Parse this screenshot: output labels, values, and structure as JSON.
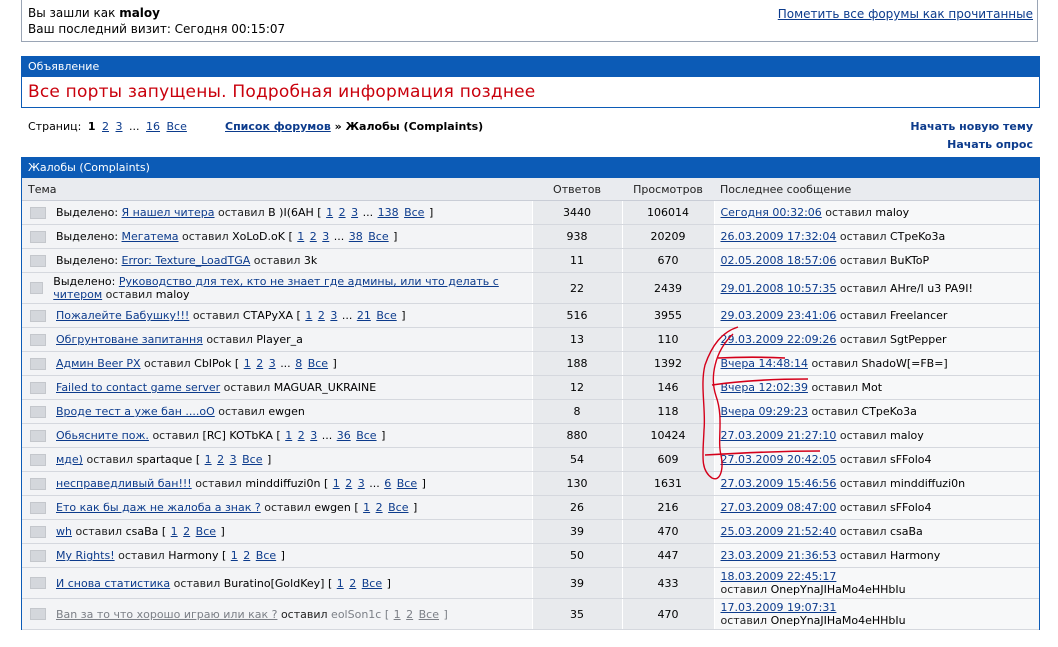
{
  "login": {
    "logged_as_prefix": "Вы зашли как",
    "username": "maloy",
    "last_visit": "Ваш последний визит: Сегодня 00:15:07",
    "mark_read": "Пометить все форумы как прочитанные"
  },
  "announcement": {
    "header": "Объявление",
    "text": "Все порты запущены. Подробная информация позднее"
  },
  "pager": {
    "label": "Страниц:",
    "current": "1",
    "p2": "2",
    "p3": "3",
    "dots": "...",
    "last": "16",
    "all": "Все"
  },
  "breadcrumb": {
    "link": "Список форумов",
    "sep": "»",
    "current": "Жалобы (Complaints)"
  },
  "actions": {
    "new_topic": "Начать новую тему",
    "new_poll": "Начать опрос"
  },
  "forum": {
    "title": "Жалобы (Complaints)",
    "col_topic": "Тема",
    "col_replies": "Ответов",
    "col_views": "Просмотров",
    "col_last": "Последнее сообщение"
  },
  "rows": [
    {
      "prefix": "Выделено:",
      "title": "Я нашел читера",
      "by": "оставил",
      "author": "B )I(6AH",
      "pages": [
        "1",
        "2",
        "3",
        "...",
        "138",
        "Все"
      ],
      "replies": "3440",
      "views": "106014",
      "last_date": "Сегодня 00:32:06",
      "last_by": "оставил",
      "last_author": "maloy"
    },
    {
      "prefix": "Выделено:",
      "title": "Мегатема",
      "by": "оставил",
      "author": "XoLoD.oK",
      "pages": [
        "1",
        "2",
        "3",
        "...",
        "38",
        "Все"
      ],
      "replies": "938",
      "views": "20209",
      "last_date": "26.03.2009 17:32:04",
      "last_by": "оставил",
      "last_author": "CTpeKo3a"
    },
    {
      "prefix": "Выделено:",
      "title": "Error: Texture_LoadTGA",
      "by": "оставил",
      "author": "3k",
      "pages": [],
      "replies": "11",
      "views": "670",
      "last_date": "02.05.2008 18:57:06",
      "last_by": "оставил",
      "last_author": "BuKToP"
    },
    {
      "prefix": "Выделено:",
      "title": "Руководство для тех, кто не знает где админы, или что делать с читером",
      "by": "оставил",
      "author": "maloy",
      "pages": [],
      "replies": "22",
      "views": "2439",
      "last_date": "29.01.2008 10:57:35",
      "last_by": "оставил",
      "last_author": "AHre/I u3 PA9I!"
    },
    {
      "prefix": "",
      "title": "Пожалейте Бабушку!!!",
      "by": "оставил",
      "author": "СТАРуХА",
      "pages": [
        "1",
        "2",
        "3",
        "...",
        "21",
        "Все"
      ],
      "replies": "516",
      "views": "3955",
      "last_date": "29.03.2009 23:41:06",
      "last_by": "оставил",
      "last_author": "Freelancer"
    },
    {
      "prefix": "",
      "title": "Обгрунтоване запитання",
      "by": "оставил",
      "author": "Player_a",
      "pages": [],
      "replies": "13",
      "views": "110",
      "last_date": "29.03.2009 22:09:26",
      "last_by": "оставил",
      "last_author": "SgtPepper"
    },
    {
      "prefix": "",
      "title": "Админ Beer PX",
      "by": "оставил",
      "author": "CbIPok",
      "pages": [
        "1",
        "2",
        "3",
        "...",
        "8",
        "Все"
      ],
      "replies": "188",
      "views": "1392",
      "last_date": "Вчера 14:48:14",
      "last_by": "оставил",
      "last_author": "ShadoW[=FB=]"
    },
    {
      "prefix": "",
      "title": "Failed to contact game server",
      "by": "оставил",
      "author": "MAGUAR_UKRAINE",
      "pages": [],
      "replies": "12",
      "views": "146",
      "last_date": "Вчера 12:02:39",
      "last_by": "оставил",
      "last_author": "Mot"
    },
    {
      "prefix": "",
      "title": "Вроде тест а уже бан ....oO",
      "by": "оставил",
      "author": "ewgen",
      "pages": [],
      "replies": "8",
      "views": "118",
      "last_date": "Вчера 09:29:23",
      "last_by": "оставил",
      "last_author": "CTpeKo3a"
    },
    {
      "prefix": "",
      "title": "Обьясните пож.",
      "by": "оставил",
      "author": "[RC] KOTbKA",
      "pages": [
        "1",
        "2",
        "3",
        "...",
        "36",
        "Все"
      ],
      "replies": "880",
      "views": "10424",
      "last_date": "27.03.2009 21:27:10",
      "last_by": "оставил",
      "last_author": "maloy"
    },
    {
      "prefix": "",
      "title": "мде)",
      "by": "оставил",
      "author": "spartaque",
      "pages": [
        "1",
        "2",
        "3",
        "Все"
      ],
      "replies": "54",
      "views": "609",
      "last_date": "27.03.2009 20:42:05",
      "last_by": "оставил",
      "last_author": "sFFolo4"
    },
    {
      "prefix": "",
      "title": "несправедливый бан!!!",
      "by": "оставил",
      "author": "minddiffuzi0n",
      "pages": [
        "1",
        "2",
        "3",
        "...",
        "6",
        "Все"
      ],
      "replies": "130",
      "views": "1631",
      "last_date": "27.03.2009 15:46:56",
      "last_by": "оставил",
      "last_author": "minddiffuzi0n"
    },
    {
      "prefix": "",
      "title": "Ето как бы даж не жалоба а знак ?",
      "by": "оставил",
      "author": "ewgen",
      "pages": [
        "1",
        "2",
        "Все"
      ],
      "replies": "26",
      "views": "216",
      "last_date": "27.03.2009 08:47:00",
      "last_by": "оставил",
      "last_author": "sFFolo4"
    },
    {
      "prefix": "",
      "title": "wh",
      "by": "оставил",
      "author": "csaBa",
      "pages": [
        "1",
        "2",
        "Все"
      ],
      "replies": "39",
      "views": "470",
      "last_date": "25.03.2009 21:52:40",
      "last_by": "оставил",
      "last_author": "csaBa"
    },
    {
      "prefix": "",
      "title": "My Rights!",
      "by": "оставил",
      "author": "Harmony",
      "pages": [
        "1",
        "2",
        "Все"
      ],
      "replies": "50",
      "views": "447",
      "last_date": "23.03.2009 21:36:53",
      "last_by": "оставил",
      "last_author": "Harmony"
    },
    {
      "prefix": "",
      "title": "И снова статистика",
      "by": "оставил",
      "author": "Buratino[GoldKey]",
      "pages": [
        "1",
        "2",
        "Все"
      ],
      "replies": "39",
      "views": "433",
      "last_date": "18.03.2009 22:45:17",
      "last_by": "оставил",
      "last_author": "OnepYnaJIHaMo4eHHbIu",
      "two_line": true
    },
    {
      "prefix": "",
      "title": "Ban за то что хорошо играю или как ?",
      "by": "оставил",
      "author": "eolSon1c",
      "pages": [
        "1",
        "2",
        "Все"
      ],
      "replies": "35",
      "views": "470",
      "last_date": "17.03.2009 19:07:31",
      "last_by": "оставил",
      "last_author": "OnepYnaJIHaMo4eHHbIu",
      "two_line": true,
      "gray": true
    }
  ],
  "colors": {
    "header_blue": "#0c5bb6",
    "announce_red": "#c9000c",
    "annotation_red": "#d4001a"
  }
}
